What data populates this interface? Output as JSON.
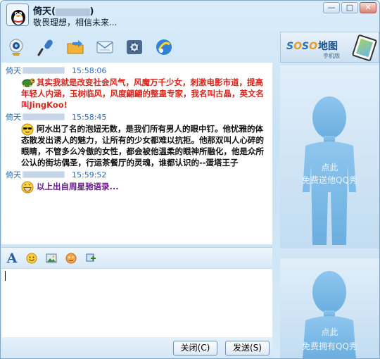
{
  "window": {
    "contact_name": "倚天(",
    "contact_qq_masked": "1155555",
    "contact_name_close": ")",
    "contact_status": "敬畏理想，相信未来...",
    "controls": {
      "minimize": "—",
      "maximize": "□",
      "close": "✕"
    }
  },
  "toolbar": {
    "items": [
      {
        "name": "video-call",
        "icon": "webcam-icon"
      },
      {
        "name": "voice-call",
        "icon": "microphone-icon"
      },
      {
        "name": "send-file",
        "icon": "folder-icon"
      },
      {
        "name": "send-sms",
        "icon": "mail-icon"
      },
      {
        "name": "app-settings",
        "icon": "gear-icon"
      },
      {
        "name": "more-apps",
        "icon": "apps-icon"
      }
    ]
  },
  "history": {
    "messages": [
      {
        "sender": "倚天",
        "time": "15:58:06",
        "emoticon": "turtle-emoticon",
        "color": "#d8261d",
        "text": "其实我就是改变社会风气，风魔万千少女，刺激电影市道，提高年轻人内涵，玉树临风，风度翩翩的整蛊专家，我名叫古晶，英文名叫JingKoo!"
      },
      {
        "sender": "倚天",
        "time": "15:58:45",
        "emoticon": "cool-sunglasses-emoticon",
        "color": "#111111",
        "text": "阿水出了名的泡妞无数，是我们所有男人的眼中钉。他忧雅的体态散发出诱人的魅力，让所有的少女都难以抗拒。他那双叫人心碎的眼睛，不管多么冷傲的女性，都会被他温柔的眼神所融化，他是众所公认的街坊偶圣，行运茶餐厅的灵魂，谁都认识的--蛋塔王子"
      },
      {
        "sender": "倚天",
        "time": "15:59:52",
        "emoticon": "grin-emoticon",
        "color": "#6a1b8a",
        "text": "以上出自周星驰语录..."
      }
    ]
  },
  "input_toolbar": {
    "font_label": "A",
    "items": [
      "font-icon",
      "smiley-icon",
      "image-icon",
      "magic-face-icon",
      "screenshot-icon"
    ]
  },
  "input": {
    "value": ""
  },
  "buttons": {
    "close": "关闭(C)",
    "send": "发送(S)"
  },
  "right_panel": {
    "map_ad": {
      "logo_prefix": "S",
      "logo_o": "O",
      "logo_s": "S",
      "logo_o2": "O",
      "logo_cn": "地图",
      "sub": "手机版"
    },
    "show_top": {
      "line1": "点此",
      "line2": "免费送他QQ秀"
    },
    "show_bottom": {
      "line1": "点此",
      "line2": "免费拥有QQ秀"
    }
  },
  "colors": {
    "accent": "#2b6eb6",
    "frame": "#d9ecfa"
  }
}
